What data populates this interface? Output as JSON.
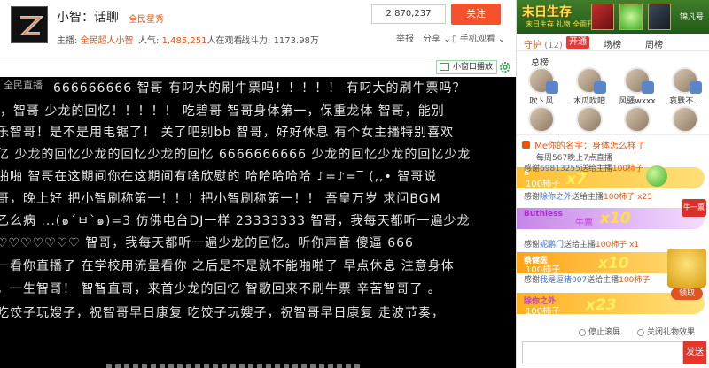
{
  "header": {
    "anchor_name": "小智：话聊",
    "anchor_tag": "全民星秀",
    "host_label": "主播:",
    "host_name": "全民超人小智",
    "popularity_label": "人气:",
    "popularity_value": "1,485,251",
    "popularity_suffix": "人在观看",
    "power_label": "战斗力:",
    "power_value": "1173.98万",
    "follow_count": "2,870,237",
    "follow_label": "关注",
    "report_label": "举报",
    "share_label": "分享",
    "phone_label": "手机观看"
  },
  "video_toolbar": {
    "mini_play_label": "小窗口播放"
  },
  "video": {
    "logo": "全民直播",
    "danmaku": [
      "666666666  智哥  有叼大的刷牛票吗！！！！！  有叼大的刷牛票吗？",
      "，智哥  少龙的回忆！！！！！  吃碧哥  智哥身体第一，保重龙体  智哥，能别",
      "乐智哥！是不是用电锯了！  关了吧别bb  智哥，好好休息  有个女主播特别喜欢",
      "亿  少龙的回忆少龙的回忆少龙的回忆  6666666666  少龙的回忆少龙的回忆少龙",
      "啪啪  智哥在这期间你在这期间有啥欣慰的  哈哈哈哈哈  ♪=♪=‾  (,,•  智哥说",
      "哥，晚上好  把小智刷称第一！！！把小智刷称第一！！  吾皇万岁  求问BGM",
      "乙么病  ...(๑´ㅂ`๑)=3  仿佛电台DJ一样  23333333  智哥，我每天都听一遍少龙",
      "♡♡♡♡♡♡♡  智哥，我每天都听一遍少龙的回忆。听你声音  傻逼  666",
      "  一看你直播了 在学校用流量看你  之后是不是就不能啪啪了  早点休息 注意身体",
      "，一生智哥！  智智直哥，来首少龙的回忆  智歌回来不刷牛票  辛苦智哥了  。",
      "  吃饺子玩嫂子，祝智哥早日康复  吃饺子玩嫂子，祝智哥早日康复  走波节奏，"
    ]
  },
  "side": {
    "banner_title": "末日生存",
    "banner_sub": "末日生存 礼物 全面开启",
    "banner_name": "锦凡号",
    "tabs": {
      "guard": "守护",
      "guard_count": "(12)",
      "open": "开通",
      "chang": "场榜",
      "zhou": "周榜"
    },
    "rank_title": "总榜",
    "rank_row1": [
      "吹丶风",
      "木瓜吹吧",
      "风骚wxxx",
      "哀默不..."
    ],
    "rank_row2": [
      "",
      "",
      "",
      ""
    ],
    "notice": "Me你的名字：身体怎么样了",
    "chat": [
      {
        "pre": "每周567晚上7点直播",
        "user": "",
        "mid": "",
        "gift": ""
      },
      {
        "pre": "感谢",
        "user": "69813255",
        "mid": "送给主播",
        "gift": "100柿子"
      },
      {
        "pre": "感谢",
        "user": "除你之外",
        "mid": "送给主播",
        "gift": "100柿子"
      },
      {
        "pre": "感谢",
        "user": "妮鹏门",
        "mid": "送给主播",
        "gift": "100柿子"
      },
      {
        "pre": "感谢",
        "user": "我是逗猪007",
        "mid": "送给主播",
        "gift": "100柿子"
      }
    ],
    "gift_bars": [
      {
        "name": "5",
        "desc": "100柿子",
        "count": "x7",
        "color1": "#ffbf2e",
        "color2": "#ffdf7a"
      },
      {
        "name": "Buthless",
        "desc": "牛票",
        "count": "x10",
        "color1": "#b45bd9",
        "color2": "#f2c6ff"
      },
      {
        "name": "蔡健医",
        "desc": "100柿子",
        "count": "x10",
        "color1": "#ffa31a",
        "color2": "#ffe07a"
      },
      {
        "name": "除你之外",
        "desc": "100柿子",
        "count": "x23",
        "color1": "#ffb020",
        "color2": "#ffe27c"
      }
    ],
    "gift_extra": [
      "x23",
      "x1"
    ],
    "gift_chip": "牛一票",
    "reward_label": "领取",
    "opt_stop_scroll": "停止滚屏",
    "opt_close_gift": "关闭礼物效果",
    "send_label": "发送"
  },
  "colors": {
    "accent": "#e8530e",
    "follow": "#f4512c",
    "send": "#e8352b",
    "open": "#e83838"
  }
}
